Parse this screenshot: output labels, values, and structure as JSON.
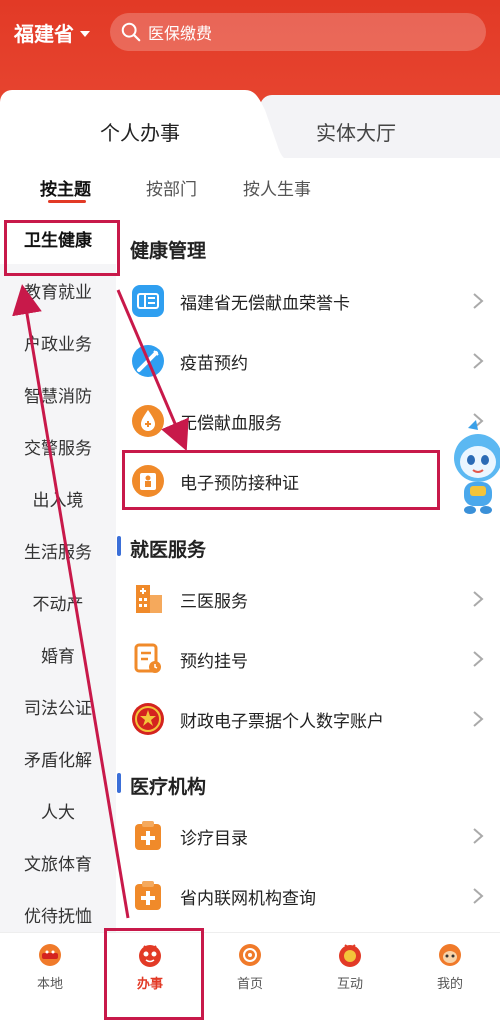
{
  "header": {
    "province": "福建省",
    "search_placeholder": "医保缴费",
    "accent": "#e23a26"
  },
  "top_tabs": [
    {
      "label": "个人办事",
      "active": true
    },
    {
      "label": "实体大厅",
      "active": false
    }
  ],
  "sub_tabs": [
    {
      "label": "按主题",
      "active": true
    },
    {
      "label": "按部门",
      "active": false
    },
    {
      "label": "按人生事",
      "active": false
    }
  ],
  "sidebar": {
    "items": [
      {
        "label": "卫生健康",
        "active": true
      },
      {
        "label": "教育就业"
      },
      {
        "label": "户政业务"
      },
      {
        "label": "智慧消防"
      },
      {
        "label": "交警服务"
      },
      {
        "label": "出入境"
      },
      {
        "label": "生活服务"
      },
      {
        "label": "不动产"
      },
      {
        "label": "婚育"
      },
      {
        "label": "司法公证"
      },
      {
        "label": "矛盾化解"
      },
      {
        "label": "人大"
      },
      {
        "label": "文旅体育"
      },
      {
        "label": "优待抚恤"
      }
    ]
  },
  "sections": [
    {
      "title": "健康管理",
      "items": [
        {
          "label": "福建省无偿献血荣誉卡",
          "icon": "blood-card-icon"
        },
        {
          "label": "疫苗预约",
          "icon": "vaccine-icon"
        },
        {
          "label": "无偿献血服务",
          "icon": "blood-drop-icon"
        },
        {
          "label": "电子预防接种证",
          "icon": "vaccination-cert-icon"
        }
      ]
    },
    {
      "title": "就医服务",
      "items": [
        {
          "label": "三医服务",
          "icon": "hospital-icon"
        },
        {
          "label": "预约挂号",
          "icon": "appointment-icon"
        },
        {
          "label": "财政电子票据个人数字账户",
          "icon": "finance-badge-icon"
        }
      ]
    },
    {
      "title": "医疗机构",
      "items": [
        {
          "label": "诊疗目录",
          "icon": "medical-catalog-icon"
        },
        {
          "label": "省内联网机构查询",
          "icon": "institution-query-icon"
        }
      ]
    }
  ],
  "bottom_nav": [
    {
      "label": "本地",
      "active": false
    },
    {
      "label": "办事",
      "active": true
    },
    {
      "label": "首页",
      "active": false
    },
    {
      "label": "互动",
      "active": false
    },
    {
      "label": "我的",
      "active": false
    }
  ]
}
